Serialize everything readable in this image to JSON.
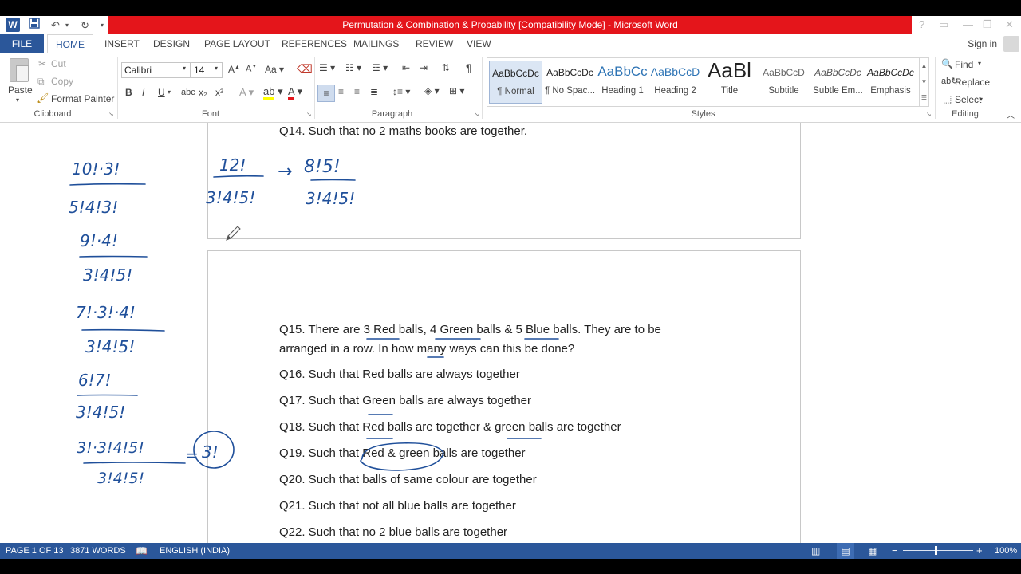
{
  "window": {
    "title": "Permutation & Combination & Probability [Compatibility Mode] - Microsoft Word",
    "help_label": "?",
    "accent": "#e4151b",
    "status_color": "#2b579a"
  },
  "tabs": [
    "FILE",
    "HOME",
    "INSERT",
    "DESIGN",
    "PAGE LAYOUT",
    "REFERENCES",
    "MAILINGS",
    "REVIEW",
    "VIEW"
  ],
  "signin": "Sign in",
  "ribbon": {
    "clipboard": {
      "paste": "Paste",
      "cut": "Cut",
      "copy": "Copy",
      "format_painter": "Format Painter",
      "label": "Clipboard"
    },
    "font": {
      "name": "Calibri",
      "size": "14",
      "bold": "B",
      "italic": "I",
      "underline": "U",
      "strike": "abc",
      "sub": "x₂",
      "sup": "x²",
      "label": "Font"
    },
    "paragraph": {
      "label": "Paragraph"
    },
    "styles": {
      "label": "Styles",
      "items": [
        {
          "sample": "AaBbCcDc",
          "name": "¶ Normal"
        },
        {
          "sample": "AaBbCcDc",
          "name": "¶ No Spac..."
        },
        {
          "sample": "AaBbCc",
          "name": "Heading 1"
        },
        {
          "sample": "AaBbCcD",
          "name": "Heading 2"
        },
        {
          "sample": "AaBl",
          "name": "Title"
        },
        {
          "sample": "AaBbCcD",
          "name": "Subtitle"
        },
        {
          "sample": "AaBbCcDc",
          "name": "Subtle Em..."
        },
        {
          "sample": "AaBbCcDc",
          "name": "Emphasis"
        }
      ]
    },
    "editing": {
      "find": "Find",
      "replace": "Replace",
      "select": "Select",
      "label": "Editing"
    }
  },
  "document": {
    "q14": "Q14. Such that no 2 maths books are together.",
    "q15_line1": "Q15. There are 3 Red balls, 4 Green balls & 5 Blue balls. They are to be",
    "q15_line2": "arranged in a row. In how many ways can this be done?",
    "q16": "Q16. Such that Red balls are always together",
    "q17": "Q17. Such that Green balls are always together",
    "q18": "Q18. Such that Red balls are together & green balls are together",
    "q19": "Q19. Such that Red & green balls are together",
    "q20": "Q20. Such that balls of same colour are together",
    "q21": "Q21. Such that not all blue balls are together",
    "q22": "Q22. Such that no 2 blue balls are together",
    "ink_color": "#1f4f9a",
    "handwriting": {
      "top_left_num": "12!",
      "top_left_den": "3!4!5!",
      "top_right_num": "8!5!",
      "top_right_den": "3!4!5!",
      "s1_num": "10!·3!",
      "s1_den": "5!4!3!",
      "s2_num": "9!·4!",
      "s2_den": "3!4!5!",
      "s3_num": "7!·3!·4!",
      "s3_den": "3!4!5!",
      "s4_num": "6!7!",
      "s4_den": "3!4!5!",
      "s5_num": "3!·3!4!5!",
      "s5_den": "3!4!5!",
      "s5_result": "3!"
    }
  },
  "status": {
    "page": "PAGE 1 OF 13",
    "words": "3871 WORDS",
    "language": "ENGLISH (INDIA)",
    "zoom": "100%",
    "zoom_minus": "−",
    "zoom_plus": "+"
  }
}
